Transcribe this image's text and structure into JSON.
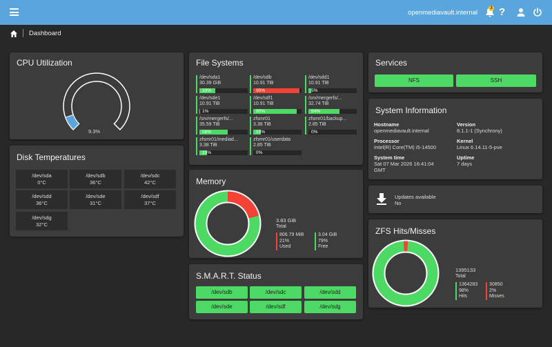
{
  "header": {
    "hostname": "openmediavault.internal",
    "notification_count": "3"
  },
  "breadcrumb": {
    "label": "Dashboard"
  },
  "cpu": {
    "title": "CPU Utilization",
    "percent": 9.3,
    "value_text": "9.3%"
  },
  "disk_temps": {
    "title": "Disk Temperatures",
    "items": [
      {
        "device": "/dev/sda",
        "temp": "0°C"
      },
      {
        "device": "/dev/sdb",
        "temp": "36°C"
      },
      {
        "device": "/dev/sdc",
        "temp": "42°C"
      },
      {
        "device": "/dev/sdd",
        "temp": "36°C"
      },
      {
        "device": "/dev/sde",
        "temp": "31°C"
      },
      {
        "device": "/dev/sdf",
        "temp": "37°C"
      },
      {
        "device": "/dev/sdg",
        "temp": "32°C"
      }
    ]
  },
  "filesystems": {
    "title": "File Systems",
    "items": [
      {
        "name": "/dev/sda1",
        "size": "30.39 GiB",
        "percent": 33,
        "percent_text": "33%"
      },
      {
        "name": "/dev/sdb",
        "size": "10.91 TiB",
        "percent": 95,
        "percent_text": "95%"
      },
      {
        "name": "/dev/sdd1",
        "size": "10.91 TiB",
        "percent": 5,
        "percent_text": "5%"
      },
      {
        "name": "/dev/sde1",
        "size": "10.91 TiB",
        "percent": 1,
        "percent_text": "1%"
      },
      {
        "name": "/dev/sdf1",
        "size": "10.91 TiB",
        "percent": 90,
        "percent_text": "90%"
      },
      {
        "name": "/srv/mergerfs/...",
        "size": "32.74 TiB",
        "percent": 64,
        "percent_text": "64%"
      },
      {
        "name": "/srv/mergerfs/...",
        "size": "35.59 TiB",
        "percent": 58,
        "percent_text": "58%"
      },
      {
        "name": "zfsmr01",
        "size": "3.38 TiB",
        "percent": 15,
        "percent_text": "15%"
      },
      {
        "name": "zfsmr01/backup...",
        "size": "2.85 TiB",
        "percent": 0,
        "percent_text": "0%"
      },
      {
        "name": "zfsmr01/mediad...",
        "size": "3.38 TiB",
        "percent": 15,
        "percent_text": "15%"
      },
      {
        "name": "zfsmr01/userdata",
        "size": "2.85 TiB",
        "percent": 0,
        "percent_text": "0%"
      }
    ]
  },
  "memory": {
    "title": "Memory",
    "total": "3.83 GiB",
    "total_label": "Total",
    "used": "806.79 MiB",
    "used_pct": "21%",
    "used_label": "Used",
    "used_fraction": 0.21,
    "free": "3.04 GiB",
    "free_pct": "79%",
    "free_label": "Free"
  },
  "smart": {
    "title": "S.M.A.R.T. Status",
    "items": [
      "/dev/sdb",
      "/dev/sdc",
      "/dev/sdd",
      "/dev/sde",
      "/dev/sdf",
      "/dev/sdg"
    ]
  },
  "services": {
    "title": "Services",
    "items": [
      "NFS",
      "SSH"
    ]
  },
  "sysinfo": {
    "title": "System Information",
    "hostname_label": "Hostname",
    "hostname": "openmediavault.internal",
    "version_label": "Version",
    "version": "8.1.1-1 (Synchrony)",
    "processor_label": "Processor",
    "processor": "Intel(R) Core(TM) i5-14500",
    "kernel_label": "Kernel",
    "kernel": "Linux 6.14.11-5-pve",
    "time_label": "System time",
    "time_line1": "Sat 07 Mar 2026 16:41:04",
    "time_line2": "GMT",
    "uptime_label": "Uptime",
    "uptime": "7 days"
  },
  "updates": {
    "title": "Updates available",
    "value": "No"
  },
  "zfs": {
    "title": "ZFS Hits/Misses",
    "total": "1395133",
    "total_label": "Total",
    "hits": "1364283",
    "hits_pct": "98%",
    "hits_label": "Hits",
    "hits_fraction": 0.978,
    "misses": "30850",
    "misses_pct": "2%",
    "misses_label": "Misses"
  },
  "colors": {
    "accent": "#5aa6dc",
    "ok": "#4cd964",
    "bad": "#f44336"
  }
}
